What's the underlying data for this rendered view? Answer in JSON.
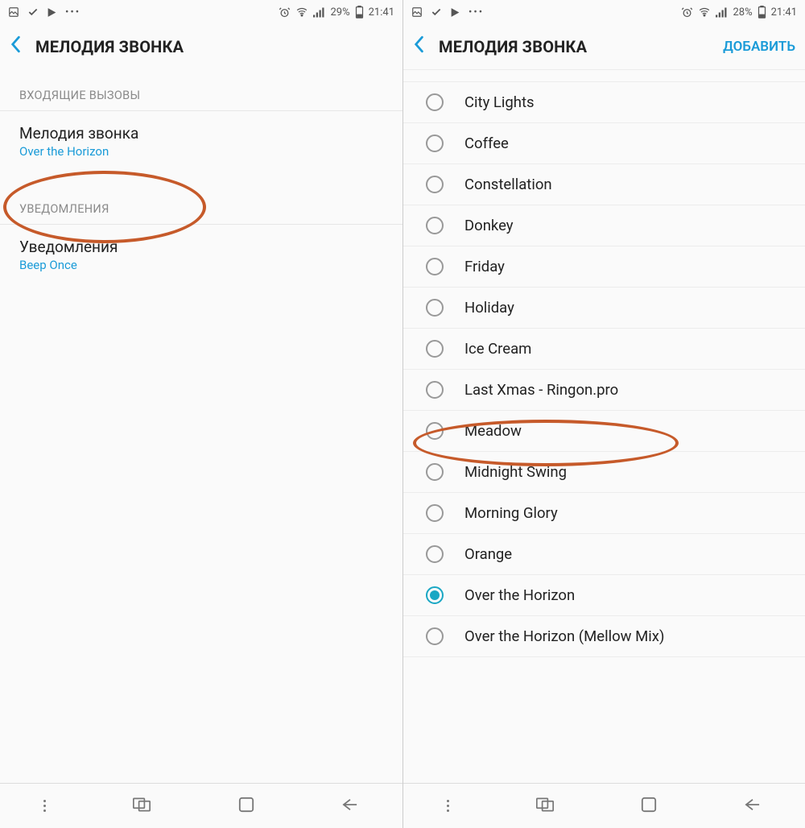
{
  "left": {
    "status": {
      "battery": "29%",
      "time": "21:41"
    },
    "header": {
      "title": "МЕЛОДИЯ ЗВОНКА"
    },
    "sections": {
      "incoming_title": "ВХОДЯЩИЕ ВЫЗОВЫ",
      "ringtone_label": "Мелодия звонка",
      "ringtone_value": "Over the Horizon",
      "notifications_title": "УВЕДОМЛЕНИЯ",
      "notifications_label": "Уведомления",
      "notifications_value": "Beep Once"
    }
  },
  "right": {
    "status": {
      "battery": "28%",
      "time": "21:41"
    },
    "header": {
      "title": "МЕЛОДИЯ ЗВОНКА",
      "action": "ДОБАВИТЬ"
    },
    "ringtones": [
      {
        "name": "City Lights",
        "selected": false
      },
      {
        "name": "Coffee",
        "selected": false
      },
      {
        "name": "Constellation",
        "selected": false
      },
      {
        "name": "Donkey",
        "selected": false
      },
      {
        "name": "Friday",
        "selected": false
      },
      {
        "name": "Holiday",
        "selected": false
      },
      {
        "name": "Ice Cream",
        "selected": false
      },
      {
        "name": "Last Xmas - Ringon.pro",
        "selected": false
      },
      {
        "name": "Meadow",
        "selected": false
      },
      {
        "name": "Midnight Swing",
        "selected": false
      },
      {
        "name": "Morning Glory",
        "selected": false
      },
      {
        "name": "Orange",
        "selected": false
      },
      {
        "name": "Over the Horizon",
        "selected": true
      },
      {
        "name": "Over the Horizon (Mellow Mix)",
        "selected": false
      }
    ],
    "highlighted_index": 7
  },
  "colors": {
    "accent": "#1a9bd8",
    "highlight_ring": "#c65a2a"
  }
}
